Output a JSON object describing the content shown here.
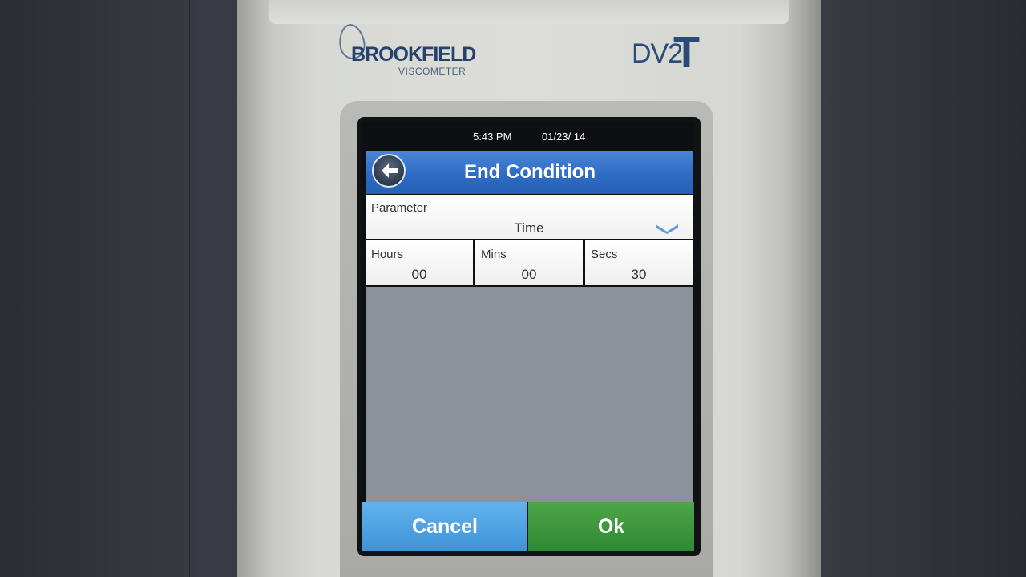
{
  "device": {
    "brand": "BROOKFIELD",
    "brand_sub": "VISCOMETER",
    "model_prefix": "DV2",
    "model_suffix": "T"
  },
  "status_bar": {
    "time": "5:43 PM",
    "date": "01/23/ 14"
  },
  "header": {
    "title": "End Condition",
    "back_icon": "back-arrow-icon"
  },
  "parameter": {
    "label": "Parameter",
    "value": "Time",
    "dropdown_icon": "chevron-down-icon"
  },
  "time_fields": [
    {
      "label": "Hours",
      "value": "00"
    },
    {
      "label": "Mins",
      "value": "00"
    },
    {
      "label": "Secs",
      "value": "30"
    }
  ],
  "buttons": {
    "cancel": "Cancel",
    "ok": "Ok"
  },
  "colors": {
    "title_bar": "#2e6cc4",
    "cancel": "#4a9fe0",
    "ok": "#3a973a",
    "content_bg": "#8d919b"
  }
}
